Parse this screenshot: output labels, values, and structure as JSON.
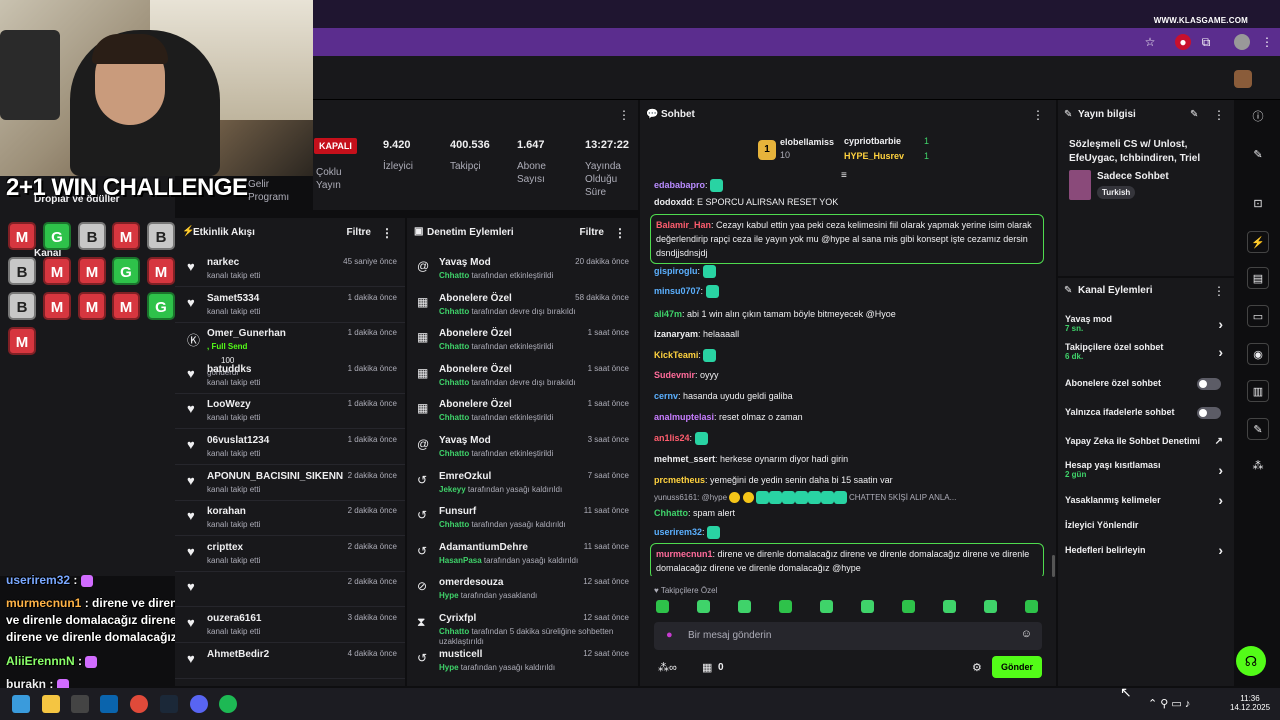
{
  "watermark": "WWW.KLASGAME.COM",
  "overlay": {
    "challenge_title": "2+1 WIN CHALLENGE",
    "partial_labels": [
      "Droplar ve ödüller",
      "Kanal",
      "S",
      "Ay"
    ],
    "results": [
      "M",
      "G",
      "B",
      "M",
      "B",
      "B",
      "M",
      "M",
      "G",
      "M",
      "B",
      "M",
      "M",
      "M",
      "G",
      "M"
    ],
    "stream_chat": [
      {
        "user": "userirem32",
        "sep": " :",
        "text": ""
      },
      {
        "user": "murmecnun1",
        "sep": " :",
        "text": "direne ve direnle domalacağız direne ve direnle domalacağız direne ve direnle domalacağız direne ve direnle domalacağız @hype"
      },
      {
        "user": "AliiErennnN",
        "sep": " :",
        "text": ""
      },
      {
        "user": "burakn",
        "sep": " :",
        "text": ""
      }
    ]
  },
  "stats": {
    "status": "KAPALI",
    "multi_label": "Çoklu Yayın",
    "income_label": "Gelir Programı",
    "viewers": "9.420",
    "viewers_label": "İzleyici",
    "followers": "400.536",
    "followers_label": "Takipçi",
    "subs": "1.647",
    "subs_label": "Abone Sayısı",
    "uptime": "13:27:22",
    "uptime_label": "Yayında Olduğu Süre"
  },
  "activity": {
    "title": "Etkinlik Akışı",
    "filter": "Filtre",
    "items": [
      {
        "name": "narkec",
        "sub": "kanalı takip etti",
        "time": "45 saniye önce",
        "icon": "heart"
      },
      {
        "name": "Samet5334",
        "sub": "kanalı takip etti",
        "time": "1 dakika önce",
        "icon": "heart"
      },
      {
        "name": "Omer_Gunerhan",
        "sub": ", Full Send",
        "extra": "100",
        "extra2": "gönderdi",
        "time": "1 dakika önce",
        "icon": "kick"
      },
      {
        "name": "batuddks",
        "sub": "kanalı takip etti",
        "time": "1 dakika önce",
        "icon": "heart"
      },
      {
        "name": "LooWezy",
        "sub": "kanalı takip etti",
        "time": "1 dakika önce",
        "icon": "heart"
      },
      {
        "name": "06vuslat1234",
        "sub": "kanalı takip etti",
        "time": "1 dakika önce",
        "icon": "heart"
      },
      {
        "name": "APONUN_BACISINI_SIKENN",
        "sub": "kanalı takip etti",
        "time": "2 dakika önce",
        "icon": "heart"
      },
      {
        "name": "korahan",
        "sub": "kanalı takip etti",
        "time": "2 dakika önce",
        "icon": "heart"
      },
      {
        "name": "cripttex",
        "sub": "kanalı takip etti",
        "time": "2 dakika önce",
        "icon": "heart"
      },
      {
        "name": "",
        "sub": "",
        "time": "2 dakika önce",
        "icon": "heart"
      },
      {
        "name": "ouzera6161",
        "sub": "kanalı takip etti",
        "time": "3 dakika önce",
        "icon": "heart"
      },
      {
        "name": "AhmetBedir2",
        "sub": "",
        "time": "4 dakika önce",
        "icon": "heart"
      }
    ]
  },
  "moderation": {
    "title": "Denetim Eylemleri",
    "filter": "Filtre",
    "items": [
      {
        "name": "Yavaş Mod",
        "who": "Chhatto",
        "sub": " tarafından etkinleştirildi",
        "time": "20 dakika önce",
        "icon": "snail"
      },
      {
        "name": "Abonelere Özel",
        "who": "Chhatto",
        "sub": " tarafından devre dışı bırakıldı",
        "time": "58 dakika önce",
        "icon": "gift"
      },
      {
        "name": "Abonelere Özel",
        "who": "Chhatto",
        "sub": " tarafından etkinleştirildi",
        "time": "1 saat önce",
        "icon": "gift"
      },
      {
        "name": "Abonelere Özel",
        "who": "Chhatto",
        "sub": " tarafından devre dışı bırakıldı",
        "time": "1 saat önce",
        "icon": "gift"
      },
      {
        "name": "Abonelere Özel",
        "who": "Chhatto",
        "sub": " tarafından etkinleştirildi",
        "time": "1 saat önce",
        "icon": "gift"
      },
      {
        "name": "Yavaş Mod",
        "who": "Chhatto",
        "sub": " tarafından etkinleştirildi",
        "time": "3 saat önce",
        "icon": "snail"
      },
      {
        "name": "EmreOzkul",
        "who": "Jekeyy",
        "sub": " tarafından yasağı kaldırıldı",
        "time": "7 saat önce",
        "icon": "undo"
      },
      {
        "name": "Funsurf",
        "who": "Chhatto",
        "sub": " tarafından yasağı kaldırıldı",
        "time": "11 saat önce",
        "icon": "undo"
      },
      {
        "name": "AdamantiumDehre",
        "who": "HasanPasa",
        "sub": " tarafından yasağı kaldırıldı",
        "time": "11 saat önce",
        "icon": "undo"
      },
      {
        "name": "omerdesouza",
        "who": "Hype",
        "sub": " tarafından yasaklandı",
        "time": "12 saat önce",
        "icon": "ban"
      },
      {
        "name": "Cyrixfpl",
        "who": "Chhatto",
        "sub": " tarafından 5 dakika süreliğine sohbetten uzaklaştırıldı",
        "time": "12 saat önce",
        "icon": "hourglass"
      },
      {
        "name": "musticell",
        "who": "Hype",
        "sub": " tarafından yasağı kaldırıldı",
        "time": "12 saat önce",
        "icon": "undo"
      }
    ]
  },
  "chat": {
    "title": "Sohbet",
    "leaderboard": [
      {
        "name": "elobellamiss",
        "value": "10"
      },
      {
        "name": "cypriotbarbie",
        "value": "1"
      },
      {
        "name": "HYPE_Husrev",
        "value": "1"
      }
    ],
    "rank": "1",
    "messages": [
      {
        "user": "edababapro",
        "color": "#b98cff",
        "text": ""
      },
      {
        "user": "dodoxdd",
        "color": "#efeff1",
        "text": "E SPORCU ALIRSAN RESET YOK"
      },
      {
        "user": "Balamir_Han",
        "color": "#ff5d6e",
        "text": "Cezayı kabul ettin yaa peki ceza kelimesini fiil olarak yapmak yerine isim olarak değerlendirip rapçi ceza ile yayın yok mu @hype al sana mis gibi konsept işte cezamız dersin dsndjjsdnsjdj",
        "highlight": true
      },
      {
        "user": "gispiroglu",
        "color": "#5bb0ff",
        "text": ""
      },
      {
        "user": "minsu0707",
        "color": "#5bb0ff",
        "text": ""
      },
      {
        "user": "ali47m",
        "color": "#3fd36a",
        "text": "abi 1 win alın çıkın tamam böyle bitmeyecek @Hyoe"
      },
      {
        "user": "izanaryam",
        "color": "#efeff1",
        "text": "helaaaall"
      },
      {
        "user": "KickTeami",
        "color": "#ffd23f",
        "text": ""
      },
      {
        "user": "Sudevmir",
        "color": "#ff6b9a",
        "text": "oyyy"
      },
      {
        "user": "cernv",
        "color": "#5bb0ff",
        "text": "hasanda uyudu geldi galiba"
      },
      {
        "user": "analmuptelasi",
        "color": "#c77dff",
        "text": "reset olmaz o zaman"
      },
      {
        "user": "an1lis24",
        "color": "#ff5d6e",
        "text": ""
      },
      {
        "user": "mehmet_ssert",
        "color": "#efeff1",
        "text": "herkese oynarım diyor hadi girin"
      },
      {
        "user": "prcmetheus",
        "color": "#ffd23f",
        "text": "yemeğini de yedin senin daha bi 15 saatin var"
      },
      {
        "reply": "yunuss6161: @hype",
        "reply_tail": "CHATTEN 5KİŞİ ALIP ANLA..."
      },
      {
        "user": "Chhatto",
        "color": "#3fd36a",
        "text": "spam alert"
      },
      {
        "user": "userirem32",
        "color": "#5bb0ff",
        "text": ""
      },
      {
        "user": "murmecnun1",
        "color": "#ff6b9a",
        "text": "direne ve direnle domalacağız direne ve direnle domalacağız direne ve direnle domalacağız direne ve direnle domalacağız @hype",
        "highlight": true
      }
    ],
    "followers_only": "Takipçilere Özel",
    "placeholder": "Bir mesaj gönderin",
    "points": "0",
    "send": "Gönder"
  },
  "stream_info": {
    "title": "Yayın bilgisi",
    "stream_title": "Sözleşmeli CS w/ Unlost, EfeUygac, Ichbindiren, Triel",
    "category": "Sadece Sohbet",
    "language": "Turkish"
  },
  "channel_actions": {
    "title": "Kanal Eylemleri",
    "items": [
      {
        "label": "Yavaş mod",
        "sub": "7 sn.",
        "control": "arrow"
      },
      {
        "label": "Takipçilere özel sohbet",
        "sub": "6 dk.",
        "control": "arrow"
      },
      {
        "label": "Abonelere özel sohbet",
        "sub": "",
        "control": "toggle"
      },
      {
        "label": "Yalnızca ifadelerle sohbet",
        "sub": "",
        "control": "toggle"
      },
      {
        "label": "Yapay Zeka ile Sohbet Denetimi",
        "sub": "",
        "control": "external"
      },
      {
        "label": "Hesap yaşı kısıtlaması",
        "sub": "2 gün",
        "control": "arrow"
      },
      {
        "label": "Yasaklanmış kelimeler",
        "sub": "",
        "control": "arrow"
      },
      {
        "label": "İzleyici Yönlendir",
        "sub": "",
        "control": "none"
      },
      {
        "label": "Hedefleri belirleyin",
        "sub": "",
        "control": "arrow"
      }
    ]
  },
  "taskbar": {
    "time": "11:36",
    "date": "14.12.2025"
  },
  "colors": {
    "accent": "#53fc18",
    "purple": "#5b2d8e",
    "panel": "#18181b"
  }
}
